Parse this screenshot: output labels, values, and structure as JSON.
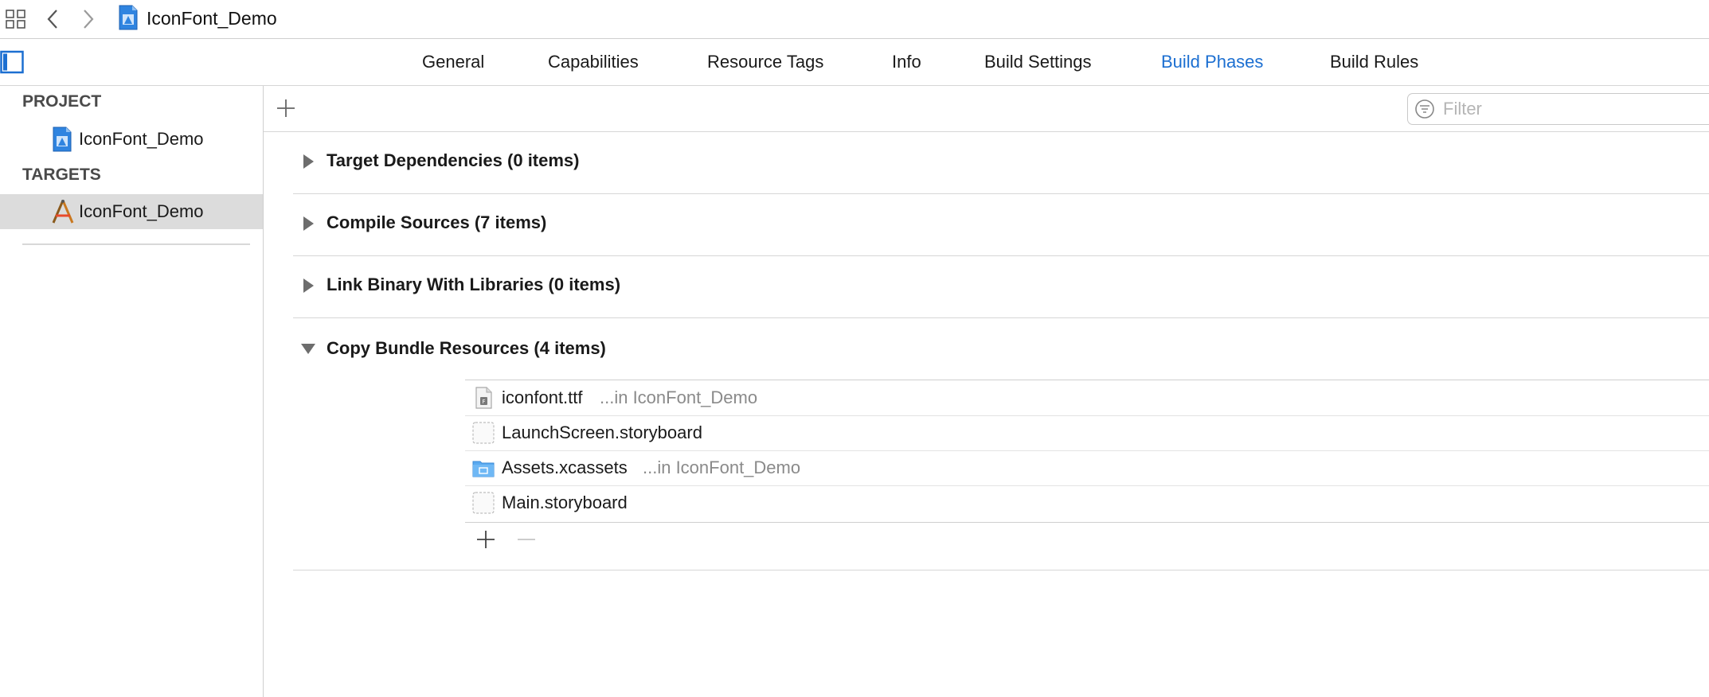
{
  "jump_bar": {
    "title": "IconFont_Demo"
  },
  "tabs": [
    {
      "label": "General"
    },
    {
      "label": "Capabilities"
    },
    {
      "label": "Resource Tags"
    },
    {
      "label": "Info"
    },
    {
      "label": "Build Settings"
    },
    {
      "label": "Build Phases",
      "active": true
    },
    {
      "label": "Build Rules"
    }
  ],
  "sidebar": {
    "project_header": "PROJECT",
    "project_item": "IconFont_Demo",
    "targets_header": "TARGETS",
    "target_item": "IconFont_Demo"
  },
  "filter": {
    "placeholder": "Filter"
  },
  "phases": [
    {
      "title": "Target Dependencies",
      "count": "(0 items)",
      "expanded": false
    },
    {
      "title": "Compile Sources",
      "count": "(7 items)",
      "expanded": false
    },
    {
      "title": "Link Binary With Libraries",
      "count": "(0 items)",
      "expanded": false
    },
    {
      "title": "Copy Bundle Resources",
      "count": "(4 items)",
      "expanded": true
    }
  ],
  "resources": [
    {
      "name": "iconfont.ttf",
      "location": "...in IconFont_Demo",
      "icon": "font-file-icon"
    },
    {
      "name": "LaunchScreen.storyboard",
      "location": "",
      "icon": "storyboard-icon"
    },
    {
      "name": "Assets.xcassets",
      "location": "...in IconFont_Demo",
      "icon": "folder-icon"
    },
    {
      "name": "Main.storyboard",
      "location": "",
      "icon": "storyboard-icon"
    }
  ],
  "colors": {
    "accent": "#1c6fd1",
    "selected_row": "#dcdcdc",
    "secondary_text": "#8a8a8a"
  }
}
